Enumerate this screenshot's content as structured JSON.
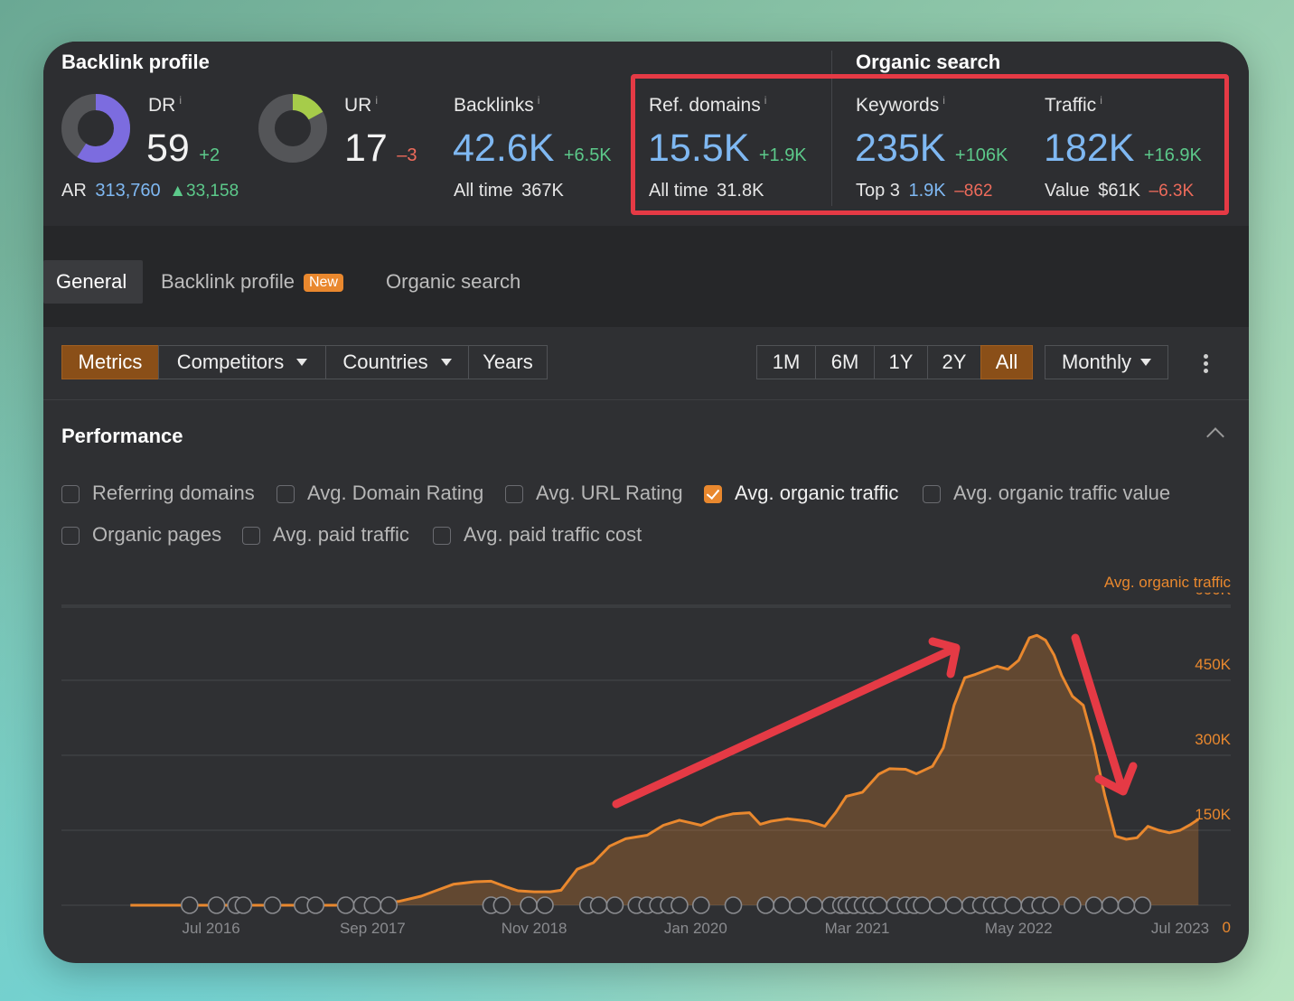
{
  "backlink_profile": {
    "title": "Backlink profile",
    "dr": {
      "label": "DR",
      "info": "i",
      "value": "59",
      "delta": "+2",
      "ring_fraction": 0.59,
      "color": "#7c6cdf"
    },
    "ar": {
      "label": "AR",
      "value": "313,760",
      "delta": "▲33,158"
    },
    "ur": {
      "label": "UR",
      "info": "i",
      "value": "17",
      "delta": "–3",
      "ring_fraction": 0.17,
      "color": "#a6cc4a"
    },
    "backlinks": {
      "label": "Backlinks",
      "info": "i",
      "value": "42.6K",
      "delta": "+6.5K",
      "sub_label": "All time",
      "sub_value": "367K"
    },
    "ref_domains": {
      "label": "Ref. domains",
      "info": "i",
      "value": "15.5K",
      "delta": "+1.9K",
      "sub_label": "All time",
      "sub_value": "31.8K"
    }
  },
  "organic_search": {
    "title": "Organic search",
    "keywords": {
      "label": "Keywords",
      "info": "i",
      "value": "235K",
      "delta": "+106K",
      "sub_label": "Top 3",
      "sub_value": "1.9K",
      "sub_delta": "–862"
    },
    "traffic": {
      "label": "Traffic",
      "info": "i",
      "value": "182K",
      "delta": "+16.9K",
      "sub_label": "Value",
      "sub_value": "$61K",
      "sub_delta": "–6.3K"
    }
  },
  "tabs": {
    "general": "General",
    "backlink_profile": "Backlink profile",
    "new_badge": "New",
    "organic_search": "Organic search"
  },
  "toolbar": {
    "metrics": "Metrics",
    "competitors": "Competitors",
    "countries": "Countries",
    "years": "Years",
    "ranges": [
      "1M",
      "6M",
      "1Y",
      "2Y",
      "All"
    ],
    "active_range": "All",
    "interval": "Monthly"
  },
  "performance": {
    "title": "Performance",
    "checkboxes": [
      {
        "label": "Referring domains",
        "checked": false
      },
      {
        "label": "Avg. Domain Rating",
        "checked": false
      },
      {
        "label": "Avg. URL Rating",
        "checked": false
      },
      {
        "label": "Avg. organic traffic",
        "checked": true
      },
      {
        "label": "Avg. organic traffic value",
        "checked": false
      },
      {
        "label": "Organic pages",
        "checked": false
      },
      {
        "label": "Avg. paid traffic",
        "checked": false
      },
      {
        "label": "Avg. paid traffic cost",
        "checked": false
      }
    ]
  },
  "colors": {
    "accent": "#e9882e",
    "highlight": "#e53a45",
    "blue": "#7fb8f2",
    "green": "#5cc98a",
    "red": "#ee6b5b"
  },
  "chart_data": {
    "type": "area",
    "series": [
      {
        "name": "Avg. organic traffic",
        "color": "#e9882e"
      }
    ],
    "x_tick_labels": [
      "Jul 2016",
      "Sep 2017",
      "Nov 2018",
      "Jan 2020",
      "Mar 2021",
      "May 2022",
      "Jul 2023"
    ],
    "y_tick_labels": [
      "0",
      "150K",
      "300K",
      "450K",
      "600K"
    ],
    "ylim": [
      0,
      650000
    ],
    "y_scale_position": "right",
    "grid": true,
    "points": [
      [
        2015.5,
        0
      ],
      [
        2016.0,
        0
      ],
      [
        2016.5,
        0
      ],
      [
        2017.0,
        0
      ],
      [
        2017.4,
        0
      ],
      [
        2017.75,
        2000
      ],
      [
        2018.0,
        8000
      ],
      [
        2018.2,
        18000
      ],
      [
        2018.35,
        30000
      ],
      [
        2018.5,
        42000
      ],
      [
        2018.7,
        47000
      ],
      [
        2018.85,
        48000
      ],
      [
        2019.0,
        36000
      ],
      [
        2019.1,
        29000
      ],
      [
        2019.25,
        27000
      ],
      [
        2019.4,
        27000
      ],
      [
        2019.5,
        30000
      ],
      [
        2019.65,
        72000
      ],
      [
        2019.8,
        85000
      ],
      [
        2019.95,
        118000
      ],
      [
        2020.1,
        133000
      ],
      [
        2020.3,
        140000
      ],
      [
        2020.45,
        160000
      ],
      [
        2020.6,
        170000
      ],
      [
        2020.8,
        160000
      ],
      [
        2020.95,
        175000
      ],
      [
        2021.1,
        183000
      ],
      [
        2021.25,
        185000
      ],
      [
        2021.35,
        162000
      ],
      [
        2021.45,
        168000
      ],
      [
        2021.6,
        173000
      ],
      [
        2021.8,
        168000
      ],
      [
        2021.95,
        158000
      ],
      [
        2022.05,
        185000
      ],
      [
        2022.15,
        218000
      ],
      [
        2022.3,
        226000
      ],
      [
        2022.45,
        262000
      ],
      [
        2022.55,
        273000
      ],
      [
        2022.7,
        272000
      ],
      [
        2022.8,
        263000
      ],
      [
        2022.95,
        278000
      ],
      [
        2023.05,
        315000
      ],
      [
        2023.15,
        400000
      ],
      [
        2023.25,
        455000
      ],
      [
        2023.35,
        462000
      ],
      [
        2023.45,
        470000
      ],
      [
        2023.55,
        478000
      ],
      [
        2023.65,
        472000
      ],
      [
        2023.75,
        490000
      ],
      [
        2023.85,
        535000
      ],
      [
        2023.92,
        540000
      ],
      [
        2024.0,
        530000
      ],
      [
        2024.08,
        500000
      ],
      [
        2024.15,
        460000
      ],
      [
        2024.25,
        418000
      ],
      [
        2024.35,
        400000
      ],
      [
        2024.45,
        320000
      ],
      [
        2024.55,
        220000
      ],
      [
        2024.65,
        138000
      ],
      [
        2024.75,
        132000
      ],
      [
        2024.85,
        135000
      ],
      [
        2024.95,
        158000
      ],
      [
        2025.05,
        150000
      ],
      [
        2025.15,
        145000
      ],
      [
        2025.25,
        150000
      ],
      [
        2025.35,
        162000
      ],
      [
        2025.42,
        172000
      ]
    ],
    "annotation_markers": [
      2016.05,
      2016.3,
      2016.48,
      2016.55,
      2016.82,
      2017.1,
      2017.22,
      2017.5,
      2017.65,
      2017.75,
      2017.9,
      2018.85,
      2018.95,
      2019.2,
      2019.35,
      2019.75,
      2019.85,
      2020.0,
      2020.2,
      2020.3,
      2020.4,
      2020.5,
      2020.6,
      2020.8,
      2021.1,
      2021.4,
      2021.55,
      2021.7,
      2021.85,
      2022.0,
      2022.1,
      2022.15,
      2022.22,
      2022.3,
      2022.38,
      2022.45,
      2022.6,
      2022.7,
      2022.78,
      2022.85,
      2023.0,
      2023.15,
      2023.3,
      2023.4,
      2023.5,
      2023.58,
      2023.7,
      2023.85,
      2023.95,
      2024.05,
      2024.25,
      2024.45,
      2024.6,
      2024.75,
      2024.9
    ]
  }
}
